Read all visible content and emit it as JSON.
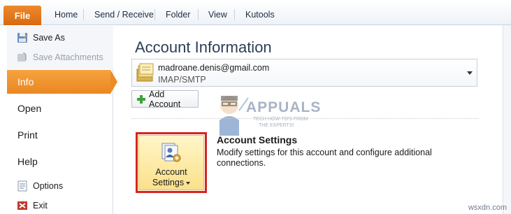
{
  "ribbon": {
    "tabs": [
      "File",
      "Home",
      "Send / Receive",
      "Folder",
      "View",
      "Kutools"
    ]
  },
  "backstage": {
    "save_as": "Save As",
    "save_attachments": "Save Attachments",
    "nav": [
      "Info",
      "Open",
      "Print",
      "Help"
    ],
    "options": "Options",
    "exit": "Exit"
  },
  "info": {
    "title": "Account Information",
    "account": {
      "email": "madroane.denis@gmail.com",
      "type": "IMAP/SMTP"
    },
    "add_account": "Add Account",
    "account_settings": {
      "button_line1": "Account",
      "button_line2": "Settings",
      "heading": "Account Settings",
      "description": "Modify settings for this account and configure additional connections."
    }
  },
  "watermark": {
    "brand": "APPUALS",
    "tagline_1": "TECH HOW-TO'S FROM",
    "tagline_2": "THE EXPERTS!",
    "site": "wsxdn.com"
  },
  "colors": {
    "file_tab": "#d8690e",
    "selected_nav": "#ea8722",
    "highlight": "#d42424",
    "tile": "#fbe08a"
  }
}
